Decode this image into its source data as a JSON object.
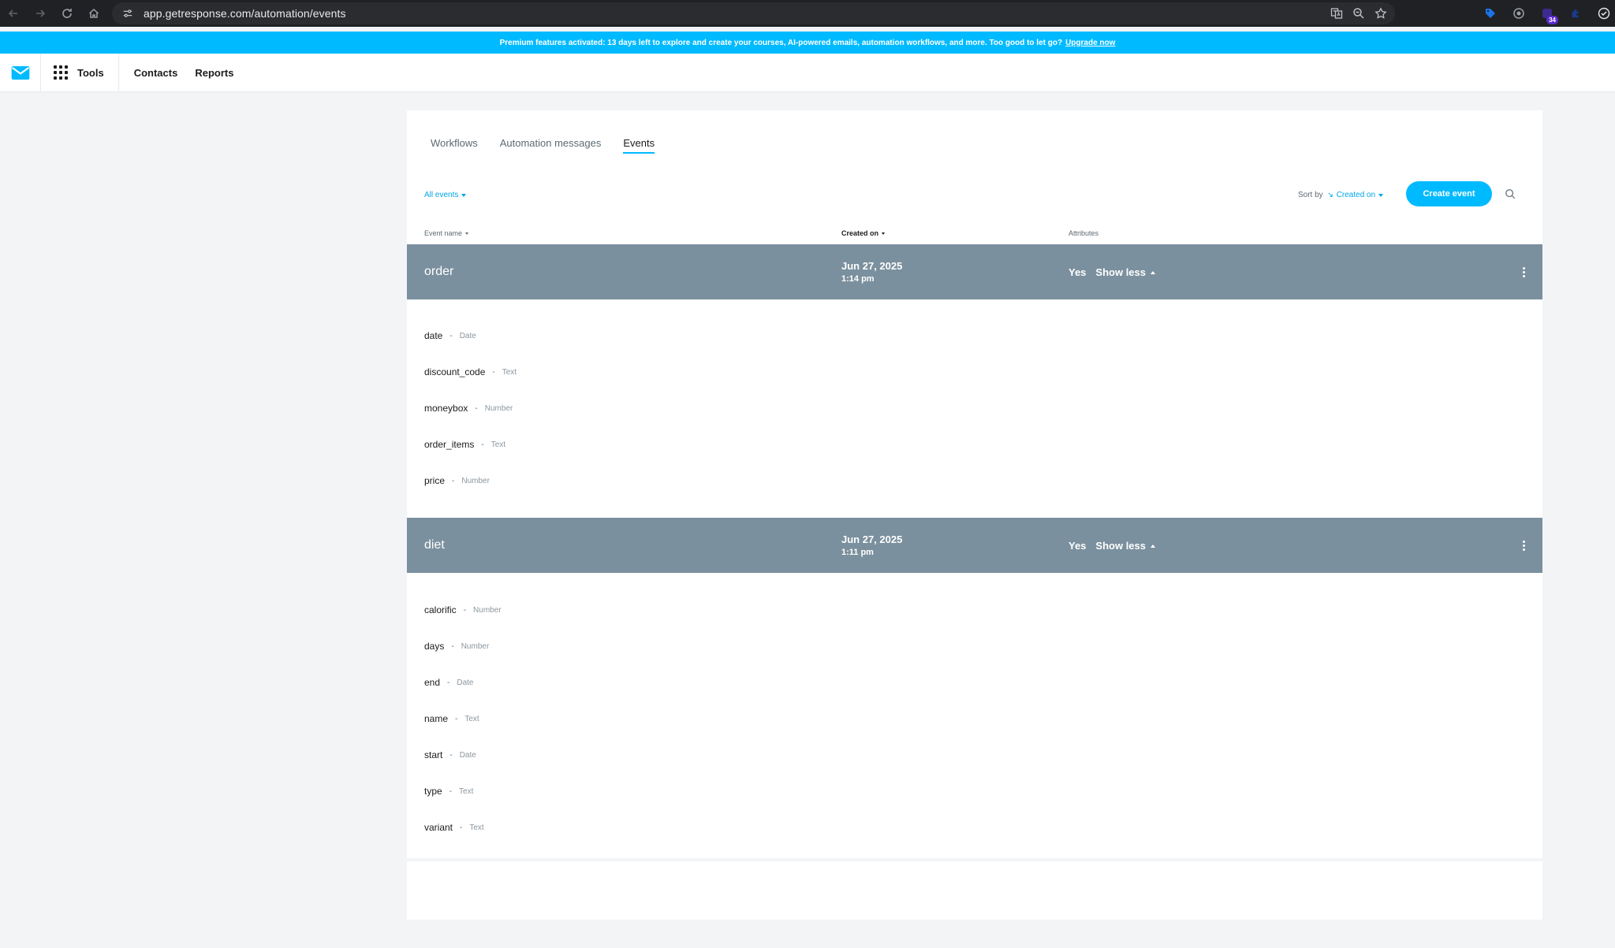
{
  "browser": {
    "url": "app.getresponse.com/automation/events",
    "extension_badge": "34"
  },
  "promo": {
    "text": "Premium features activated: 13 days left to explore and create your courses, AI-powered emails, automation workflows, and more. Too good to let go?",
    "link": "Upgrade now"
  },
  "header": {
    "tools_label": "Tools",
    "nav": [
      "Contacts",
      "Reports"
    ]
  },
  "tabs": [
    {
      "label": "Workflows",
      "active": false
    },
    {
      "label": "Automation messages",
      "active": false
    },
    {
      "label": "Events",
      "active": true
    }
  ],
  "toolbar": {
    "filter_label": "All events",
    "sort_by_label": "Sort by",
    "sort_value": "Created on",
    "create_button": "Create event"
  },
  "columns": {
    "name": "Event name",
    "created": "Created on",
    "attributes": "Attributes"
  },
  "events": [
    {
      "name": "order",
      "date": "Jun 27, 2025",
      "time": "1:14 pm",
      "has_attributes": "Yes",
      "toggle": "Show less",
      "attributes": [
        {
          "name": "date",
          "type": "Date"
        },
        {
          "name": "discount_code",
          "type": "Text"
        },
        {
          "name": "moneybox",
          "type": "Number"
        },
        {
          "name": "order_items",
          "type": "Text"
        },
        {
          "name": "price",
          "type": "Number"
        }
      ]
    },
    {
      "name": "diet",
      "date": "Jun 27, 2025",
      "time": "1:11 pm",
      "has_attributes": "Yes",
      "toggle": "Show less",
      "attributes": [
        {
          "name": "calorific",
          "type": "Number"
        },
        {
          "name": "days",
          "type": "Number"
        },
        {
          "name": "end",
          "type": "Date"
        },
        {
          "name": "name",
          "type": "Text"
        },
        {
          "name": "start",
          "type": "Date"
        },
        {
          "name": "type",
          "type": "Text"
        },
        {
          "name": "variant",
          "type": "Text"
        }
      ]
    }
  ],
  "colors": {
    "brand": "#00baff",
    "row_header": "#7b909e"
  }
}
